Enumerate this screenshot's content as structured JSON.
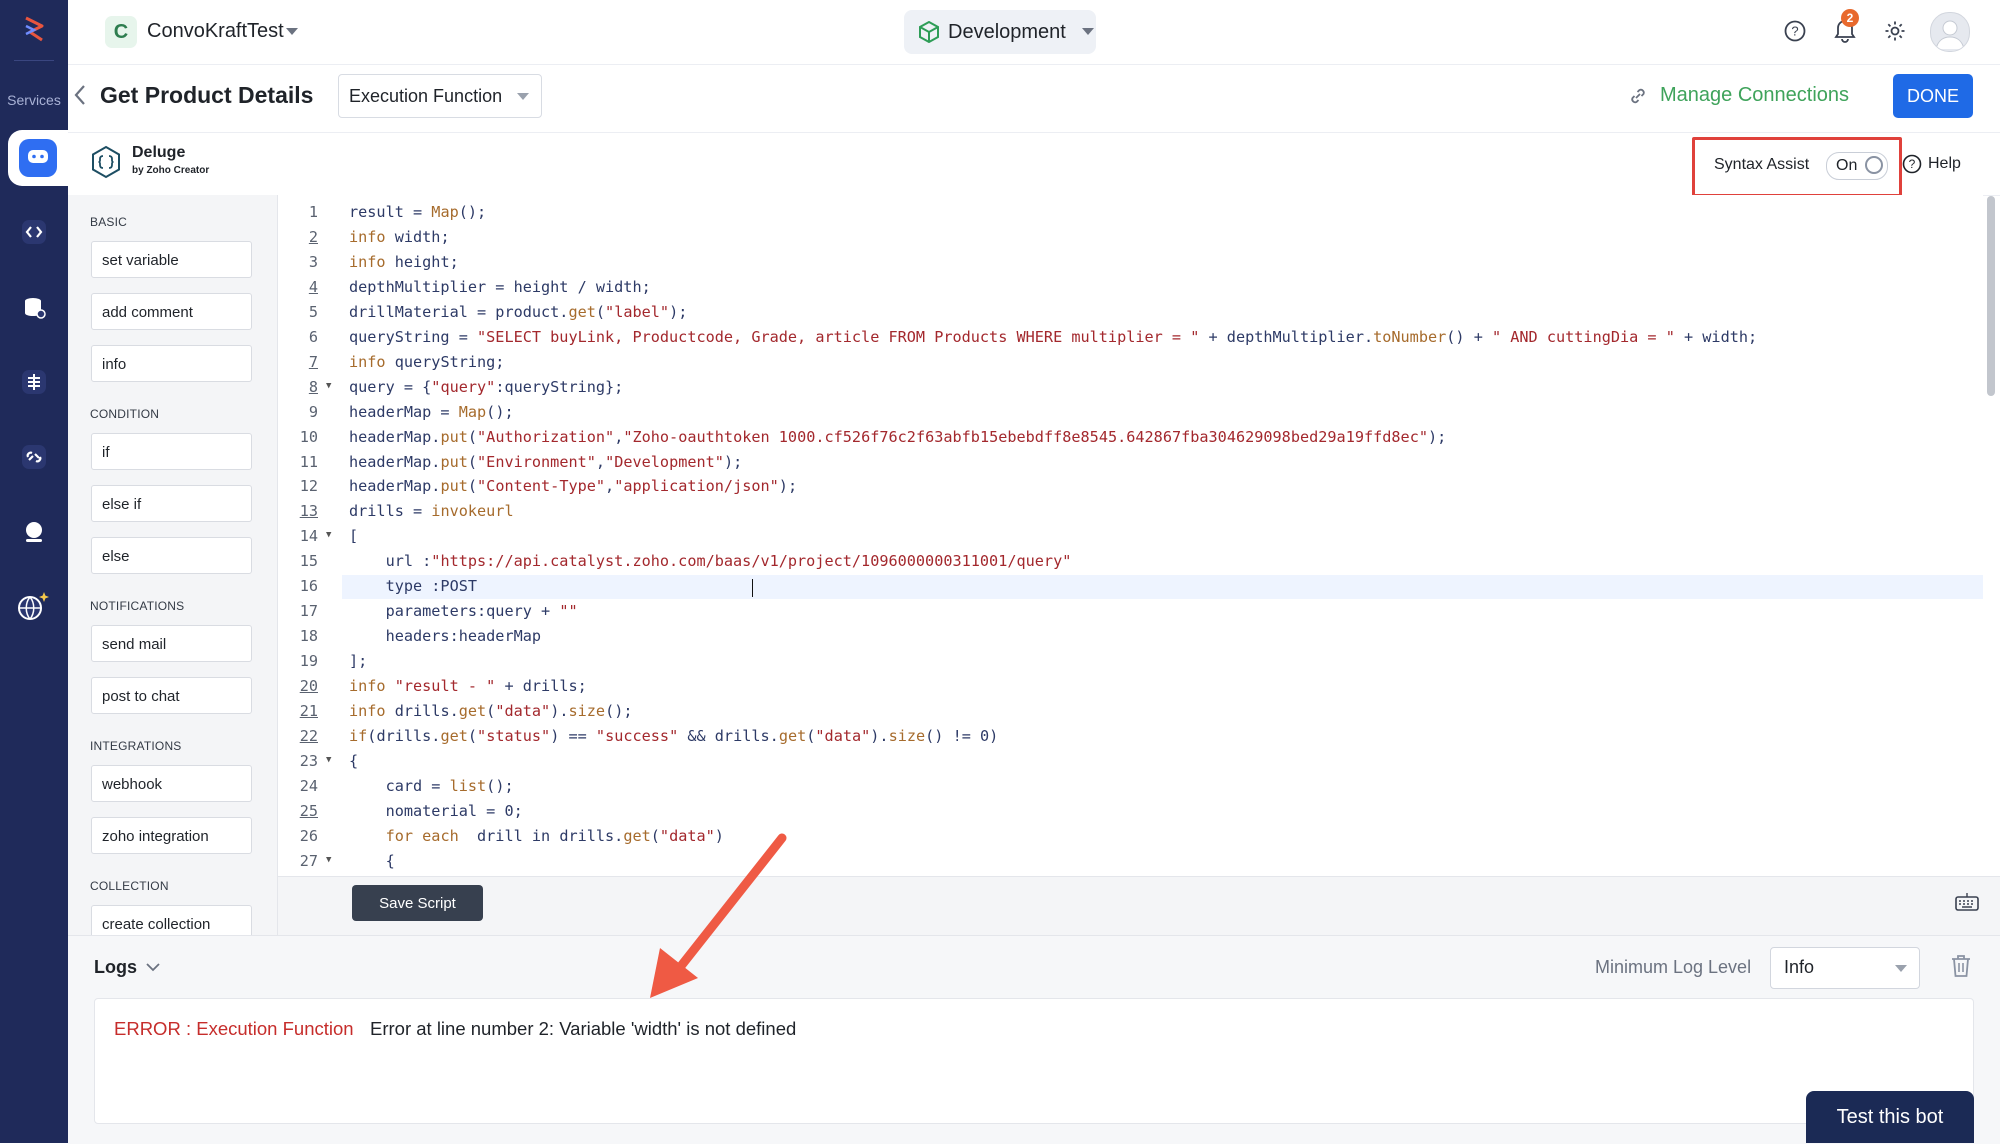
{
  "app": {
    "bot_initial": "C",
    "bot_name": "ConvoKraftTest",
    "environment": "Development",
    "notification_count": "2"
  },
  "rail": {
    "services_label": "Services"
  },
  "titlebar": {
    "title": "Get Product Details",
    "function_type": "Execution Function",
    "manage_connections": "Manage Connections",
    "done": "DONE"
  },
  "editor": {
    "language_name": "Deluge",
    "language_sub": "by Zoho Creator",
    "syntax_assist_label": "Syntax Assist",
    "syntax_assist_state": "On",
    "help_label": "Help",
    "save_label": "Save Script"
  },
  "palette": {
    "sections": [
      {
        "title": "BASIC",
        "items": [
          "set variable",
          "add comment",
          "info"
        ]
      },
      {
        "title": "CONDITION",
        "items": [
          "if",
          "else if",
          "else"
        ]
      },
      {
        "title": "NOTIFICATIONS",
        "items": [
          "send mail",
          "post to chat"
        ]
      },
      {
        "title": "INTEGRATIONS",
        "items": [
          "webhook",
          "zoho integration"
        ]
      },
      {
        "title": "COLLECTION",
        "items": [
          "create collection"
        ]
      }
    ]
  },
  "code_lines": [
    {
      "n": "1",
      "text": "result = Map();"
    },
    {
      "n": "2",
      "text": "info width;"
    },
    {
      "n": "3",
      "text": "info height;"
    },
    {
      "n": "4",
      "text": "depthMultiplier = height / width;"
    },
    {
      "n": "5",
      "text": "drillMaterial = product.get(\"label\");"
    },
    {
      "n": "6",
      "text": "queryString = \"SELECT buyLink, Productcode, Grade, article FROM Products WHERE multiplier = \" + depthMultiplier.toNumber() + \" AND cuttingDia = \" + width;"
    },
    {
      "n": "7",
      "text": "info queryString;"
    },
    {
      "n": "8",
      "text": "query = {\"query\":queryString};"
    },
    {
      "n": "9",
      "text": "headerMap = Map();"
    },
    {
      "n": "10",
      "text": "headerMap.put(\"Authorization\",\"Zoho-oauthtoken 1000.cf526f76c2f63abfb15ebebdff8e8545.642867fba304629098bed29a19ffd8ec\");"
    },
    {
      "n": "11",
      "text": "headerMap.put(\"Environment\",\"Development\");"
    },
    {
      "n": "12",
      "text": "headerMap.put(\"Content-Type\",\"application/json\");"
    },
    {
      "n": "13",
      "text": "drills = invokeurl"
    },
    {
      "n": "14",
      "text": "["
    },
    {
      "n": "15",
      "text": "    url :\"https://api.catalyst.zoho.com/baas/v1/project/1096000000311001/query\""
    },
    {
      "n": "16",
      "text": "    type :POST"
    },
    {
      "n": "17",
      "text": "    parameters:query + \"\""
    },
    {
      "n": "18",
      "text": "    headers:headerMap"
    },
    {
      "n": "19",
      "text": "];"
    },
    {
      "n": "20",
      "text": "info \"result - \" + drills;"
    },
    {
      "n": "21",
      "text": "info drills.get(\"data\").size();"
    },
    {
      "n": "22",
      "text": "if(drills.get(\"status\") == \"success\" && drills.get(\"data\").size() != 0)"
    },
    {
      "n": "23",
      "text": "{"
    },
    {
      "n": "24",
      "text": "    card = list();"
    },
    {
      "n": "25",
      "text": "    nomaterial = 0;"
    },
    {
      "n": "26",
      "text": "    for each  drill in drills.get(\"data\")"
    },
    {
      "n": "27",
      "text": "    {"
    }
  ],
  "logs": {
    "title": "Logs",
    "min_level_label": "Minimum Log Level",
    "min_level_value": "Info",
    "error_label": "ERROR : Execution Function",
    "error_message": "Error at line number 2: Variable 'width' is not defined"
  },
  "test_bot_label": "Test this bot",
  "colors": {
    "rail": "#1f2a5a",
    "accent_blue": "#1f6ae6",
    "connection_green": "#3fa35b",
    "error_red": "#c62d2b",
    "highlight_box": "#e0413b",
    "annotation_arrow": "#ef5a44"
  }
}
